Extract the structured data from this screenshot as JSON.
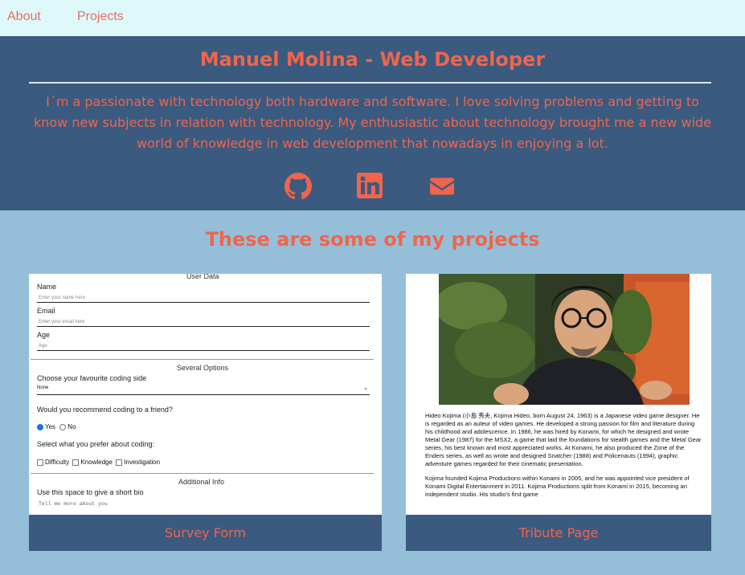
{
  "nav": {
    "about": "About",
    "projects": "Projects"
  },
  "header": {
    "title": "Manuel Molina - Web Developer",
    "intro": "I´m a passionate with technology both hardware and software. I love solving problems and getting to know new subjects in relation with technology. My enthusiastic about technology brought me a new wide world of knowledge in web development that nowadays in enjoying a lot.",
    "social": [
      "github-icon",
      "linkedin-icon",
      "envelope-icon"
    ]
  },
  "projects": {
    "heading": "These are some of my projects",
    "survey": {
      "label": "Survey Form",
      "legend_user": "User Data",
      "name_label": "Name",
      "name_ph": "Enter your name here",
      "email_label": "Email",
      "email_ph": "Enter your email here",
      "age_label": "Age",
      "age_ph": "Age",
      "legend_options": "Several Options",
      "side_label": "Choose your favourite coding side",
      "side_value": "None",
      "recommend_label": "Would you recommend coding to a friend?",
      "yes": "Yes",
      "no": "No",
      "prefer_label": "Select what you prefer about coding:",
      "chk1": "Difficulty",
      "chk2": "Knowledge",
      "chk3": "Investigation",
      "legend_info": "Additional Info",
      "bio_label": "Use this space to give a short bio",
      "bio_ph": "Tell me more about you"
    },
    "tribute": {
      "label": "Tribute Page",
      "p1": "Hideo Kojima (小島 秀夫, Kojima Hideo, born August 24, 1963) is a Japanese video game designer. He is regarded as an auteur of video games. He developed a strong passion for film and literature during his childhood and adolescence. In 1986, he was hired by Konami, for which he designed and wrote Metal Gear (1987) for the MSX2, a game that laid the foundations for stealth games and the Metal Gear series, his best known and most appreciated works. At Konami, he also produced the Zone of the Enders series, as well as wrote and designed Snatcher (1988) and Policenauts (1994), graphic adventure games regarded for their cinematic presentation.",
      "p2": "Kojima founded Kojima Productions within Konami in 2005, and he was appointed vice president of Konami Digital Entertainment in 2011. Kojima Productions split from Konami in 2015, becoming an independent studio. His studio's first game"
    }
  },
  "colors": {
    "accent": "#f0654c",
    "header_bg": "#3a5a80",
    "page_bg": "#95bfd9",
    "nav_bg": "#dff9fb"
  }
}
